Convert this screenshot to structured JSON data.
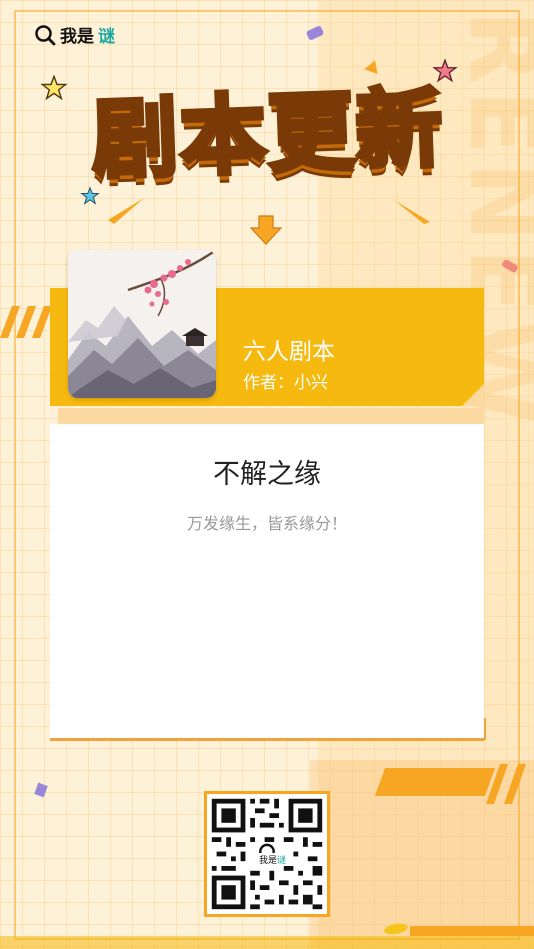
{
  "brand": {
    "logo_text": "我是",
    "logo_accent": "谜",
    "accent_color": "#1aa7a0"
  },
  "header": {
    "title": "剧本更新",
    "watermark": "RENEW"
  },
  "script": {
    "type": "六人剧本",
    "author_line": "作者：小兴",
    "name": "不解之缘",
    "tagline": "万发缘生，皆系缘分！"
  },
  "qr": {
    "label_text": "我是",
    "label_accent": "谜"
  },
  "colors": {
    "primary": "#f6b90f",
    "frame": "#f6a623",
    "background": "#fdf1d8"
  }
}
